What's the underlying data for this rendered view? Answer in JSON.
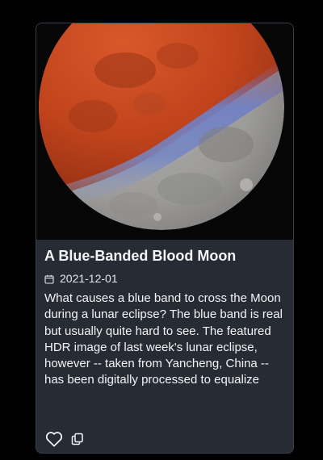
{
  "card": {
    "title": "A Blue-Banded Blood Moon",
    "date": "2021-12-01",
    "description": "What causes a blue band to cross the Moon during a lunar eclipse? The blue band is real but usually quite hard to see. The featured HDR image of last week's lunar eclipse, however -- taken from Yancheng, China -- has been digitally processed to equalize",
    "image_subject": "lunar eclipse moon with blue band",
    "icons": {
      "date": "calendar-icon",
      "like": "heart-icon",
      "copy": "copy-icon"
    }
  },
  "colors": {
    "card_background": "#262b34",
    "page_background": "#000000",
    "text": "#f3f4f6",
    "moon_red": "#c2451f",
    "moon_blue_band": "#6b82c4",
    "moon_gray": "#9a9a9a"
  }
}
